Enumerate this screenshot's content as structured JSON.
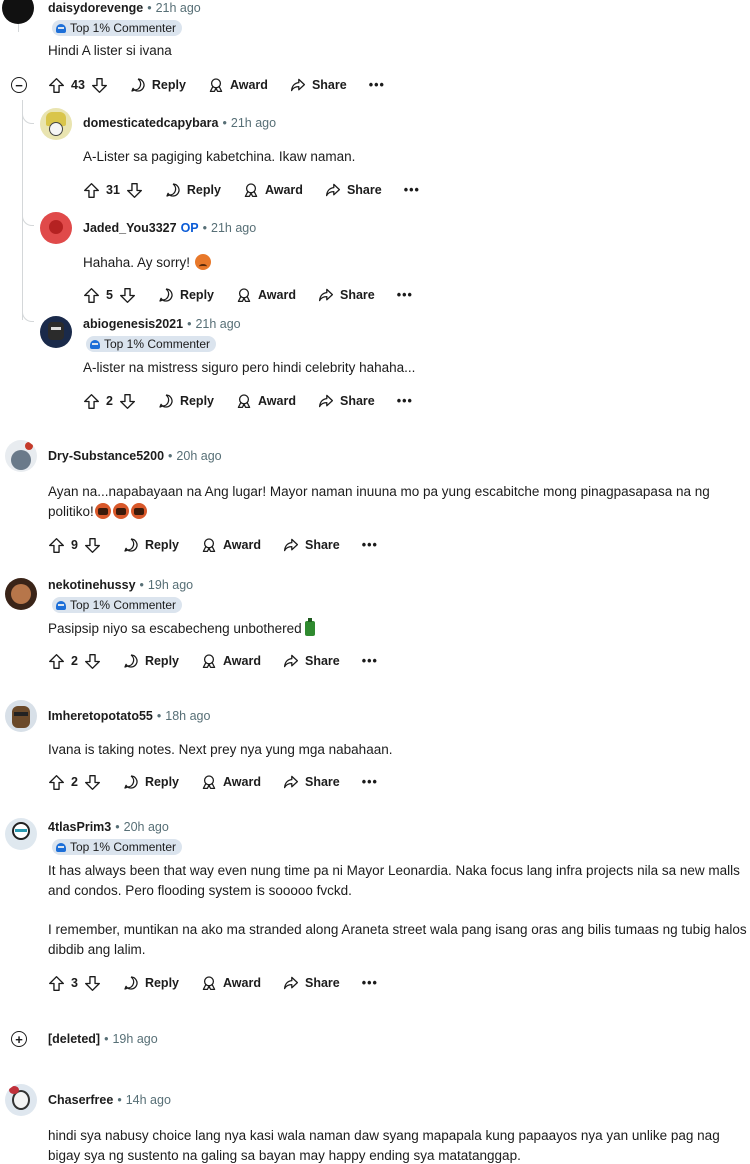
{
  "comments": {
    "c1": {
      "user": "daisydorevenge",
      "time": "21h ago",
      "badge": "Top 1% Commenter",
      "body": "Hindi A lister si ivana",
      "votes": "43",
      "reply": "Reply",
      "award": "Award",
      "share": "Share",
      "more": "•••"
    },
    "c2": {
      "user": "domesticatedcapybara",
      "time": "21h ago",
      "body": "A-Lister sa pagiging kabetchina. Ikaw naman.",
      "votes": "31",
      "reply": "Reply",
      "award": "Award",
      "share": "Share",
      "more": "•••"
    },
    "c3": {
      "user": "Jaded_You3327",
      "op": "OP",
      "time": "21h ago",
      "body": "Hahaha. Ay sorry!",
      "votes": "5",
      "reply": "Reply",
      "award": "Award",
      "share": "Share",
      "more": "•••"
    },
    "c4": {
      "user": "abiogenesis2021",
      "time": "21h ago",
      "badge": "Top 1% Commenter",
      "body": "A-lister na mistress siguro pero hindi celebrity hahaha...",
      "votes": "2",
      "reply": "Reply",
      "award": "Award",
      "share": "Share",
      "more": "•••"
    },
    "c5": {
      "user": "Dry-Substance5200",
      "time": "20h ago",
      "body": "Ayan na...napabayaan na Ang lugar! Mayor naman inuuna mo pa yung escabitche mong pinagpasapasa na ng politiko!",
      "votes": "9",
      "reply": "Reply",
      "award": "Award",
      "share": "Share",
      "more": "•••"
    },
    "c6": {
      "user": "nekotinehussy",
      "time": "19h ago",
      "badge": "Top 1% Commenter",
      "body": "Pasipsip niyo sa escabecheng unbothered",
      "votes": "2",
      "reply": "Reply",
      "award": "Award",
      "share": "Share",
      "more": "•••"
    },
    "c7": {
      "user": "Imheretopotato55",
      "time": "18h ago",
      "body": "Ivana is taking notes. Next prey nya yung mga nabahaan.",
      "votes": "2",
      "reply": "Reply",
      "award": "Award",
      "share": "Share",
      "more": "•••"
    },
    "c8": {
      "user": "4tlasPrim3",
      "time": "20h ago",
      "badge": "Top 1% Commenter",
      "body1": "It has always been that way even nung time pa ni Mayor Leonardia. Naka focus lang infra projects nila sa new malls and condos. Pero flooding system is sooooo fvckd.",
      "body2": "I remember, muntikan na ako ma stranded along Araneta street wala pang isang oras ang bilis tumaas ng tubig halos dibdib ang lalim.",
      "votes": "3",
      "reply": "Reply",
      "award": "Award",
      "share": "Share",
      "more": "•••"
    },
    "c9": {
      "user": "[deleted]",
      "time": "19h ago"
    },
    "c10": {
      "user": "Chaserfree",
      "time": "14h ago",
      "body": "hindi sya nabusy choice lang nya kasi wala naman daw syang mapapala kung papaayos nya yan unlike pag nag bigay sya ng sustento na galing sa bayan may happy ending sya matatanggap."
    }
  },
  "separator": "•"
}
